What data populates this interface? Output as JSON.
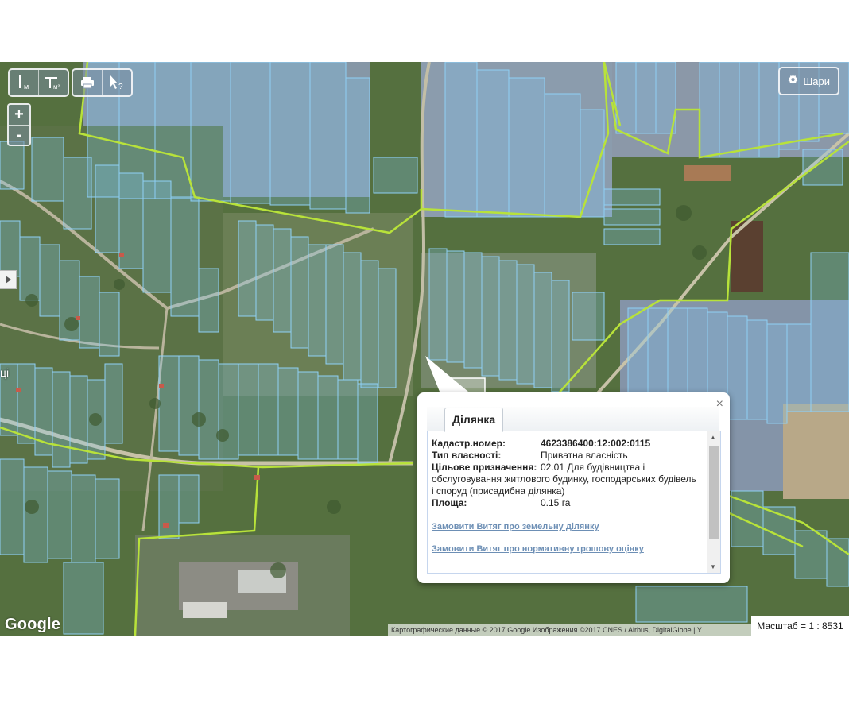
{
  "map": {
    "provider_logo": "Google",
    "attribution": "Картографические данные © 2017 Google Изображения ©2017 CNES / Airbus, DigitalGlobe | У",
    "scale_label": "Масштаб = 1 : 8531",
    "partial_label": "ці",
    "parcel_color": "#7fc8f0",
    "boundary_color": "#b8e23a"
  },
  "toolbar": {
    "measure_length_icon": "ruler-m-icon",
    "measure_area_icon": "ruler-m2-icon",
    "measure_length_unit": "м",
    "measure_area_unit": "м²",
    "print_icon": "print-icon",
    "info_cursor_icon": "info-cursor-icon",
    "info_cursor_mark": "?",
    "zoom_in": "+",
    "zoom_out": "-",
    "layers_label": "Шари",
    "layers_icon": "gear-icon"
  },
  "popup": {
    "tab_label": "Ділянка",
    "close_label": "×",
    "fields": [
      {
        "key": "Кадастр.номер:",
        "value": "4623386400:12:002:0115",
        "bold": true
      },
      {
        "key": "Тип власності:",
        "value": "Приватна власність"
      },
      {
        "key": "Цільове призначення:",
        "value": "02.01 Для будівництва і"
      },
      {
        "key": "",
        "value": "обслуговування житлового будинку, господарських будівель і споруд (присадибна ділянка)"
      },
      {
        "key": "Площа:",
        "value": "0.15 га"
      }
    ],
    "links": [
      "Замовити Витяг про земельну ділянку",
      "Замовити Витяг про нормативну грошову оцінку"
    ]
  }
}
